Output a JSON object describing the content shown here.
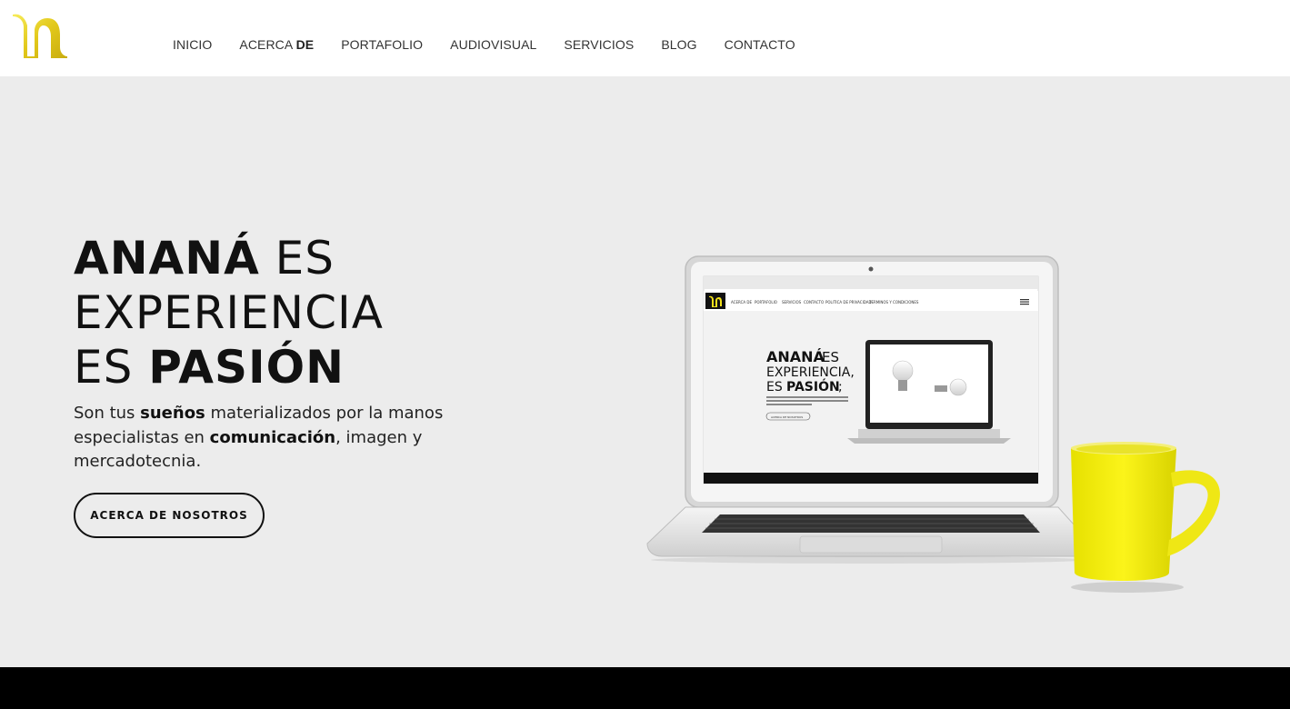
{
  "brand": {
    "accent": "#f2e01a",
    "logo_color": "#e8d21c"
  },
  "nav": {
    "items": [
      {
        "label": "INICIO"
      },
      {
        "label_a": "ACERCA ",
        "label_b": "DE"
      },
      {
        "label": "PORTAFOLIO"
      },
      {
        "label": "AUDIOVISUAL"
      },
      {
        "label": "SERVICIOS"
      },
      {
        "label": "BLOG"
      },
      {
        "label": "CONTACTO"
      }
    ]
  },
  "hero": {
    "line1_bold": "ANANÁ",
    "line1_rest": " ES",
    "line2": "EXPERIENCIA",
    "line3_pre": "ES ",
    "line3_bold": "PASIÓN",
    "sub_1": "Son tus ",
    "sub_2": "sueños",
    "sub_3": " materializados por la manos especialistas en ",
    "sub_4": "comunicación",
    "sub_5": ", imagen y mercadotecnia.",
    "cta_label": "ACERCA DE NOSOTROS"
  },
  "laptop_screen": {
    "nav_a": "ACERCA DE",
    "nav_b": "PORTAFOLIO",
    "nav_c": "SERVICIOS",
    "nav_d": "CONTACTO",
    "nav_e": "POLITICA DE PRIVACIDAD",
    "nav_f": "TERMINOS Y CONDICIONES",
    "h1_bold": "ANANÁ",
    "h1_rest": " ES",
    "h2": "EXPERIENCIA,",
    "h3_pre": "ES ",
    "h3_bold": "PASIÓN",
    "h3_post": ";",
    "mini_cta": "ACERCA DE NOSOTROS"
  }
}
